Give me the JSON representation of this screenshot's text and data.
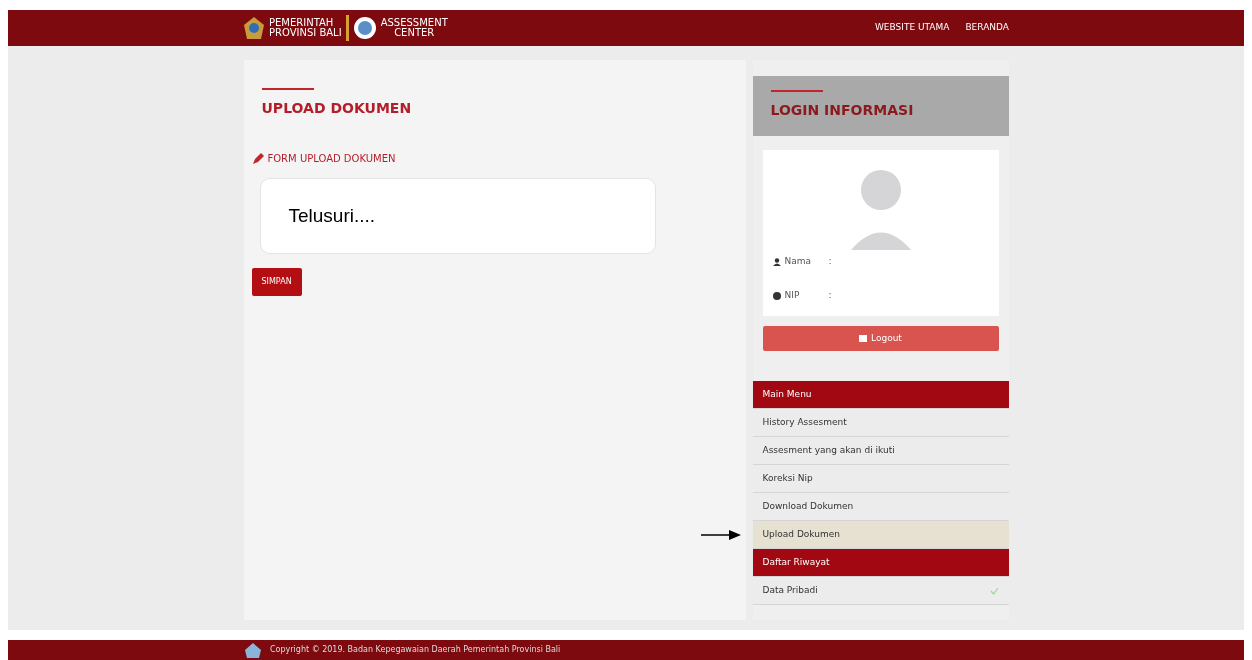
{
  "header": {
    "brand_line_1": "PEMERINTAH",
    "brand_line_2": "PROVINSI BALI",
    "center_line_1": "ASSESSMENT",
    "center_line_2": "CENTER",
    "nav_links": [
      "WEBSITE UTAMA",
      "BERANDA"
    ]
  },
  "main": {
    "title": "UPLOAD DOKUMEN",
    "form_title": "FORM UPLOAD DOKUMEN",
    "file_button": "Telusuri....",
    "save_button": "SIMPAN"
  },
  "login_info": {
    "title": "LOGIN INFORMASI",
    "fields": [
      {
        "label": "Nama",
        "value": ":"
      },
      {
        "label": "NIP",
        "value": ":"
      }
    ],
    "logout": "Logout"
  },
  "menu": [
    {
      "kind": "header",
      "label": "Main Menu",
      "selected": false,
      "done": false
    },
    {
      "kind": "link",
      "label": "History Assesment",
      "selected": false,
      "done": false
    },
    {
      "kind": "link",
      "label": "Assesment yang akan di ikuti",
      "selected": false,
      "done": false
    },
    {
      "kind": "link",
      "label": "Koreksi Nip",
      "selected": false,
      "done": false
    },
    {
      "kind": "link",
      "label": "Download Dokumen",
      "selected": false,
      "done": false
    },
    {
      "kind": "link",
      "label": "Upload Dokumen",
      "selected": true,
      "done": false
    },
    {
      "kind": "header",
      "label": "Daftar Riwayat",
      "selected": false,
      "done": false
    },
    {
      "kind": "link",
      "label": "Data Pribadi",
      "selected": false,
      "done": true
    }
  ],
  "footer": {
    "copyright": "Copyright © 2019. Badan Kepegawaian Daerah Pemerintah Provinsi Bali"
  }
}
